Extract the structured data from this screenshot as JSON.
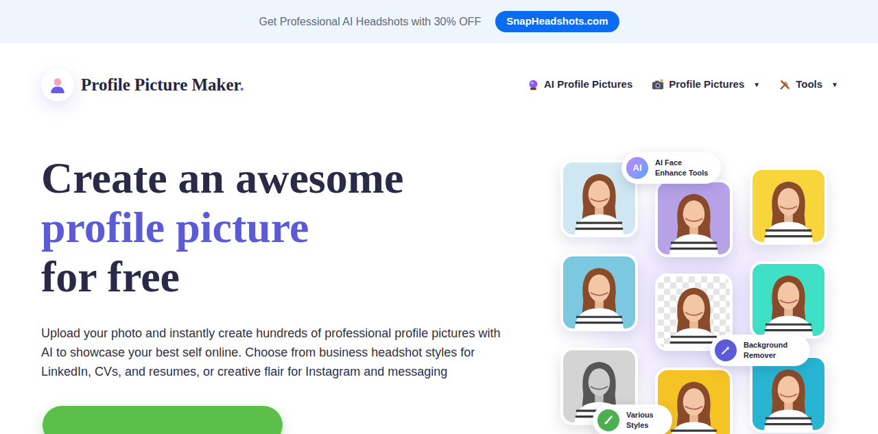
{
  "banner": {
    "text": "Get Professional AI Headshots with 30% OFF",
    "button": "SnapHeadshots.com"
  },
  "logo": {
    "name": "Profile Picture Maker",
    "dot": "."
  },
  "nav": [
    {
      "label": "AI Profile Pictures"
    },
    {
      "label": "Profile Pictures",
      "arrow": "▼"
    },
    {
      "label": "Tools",
      "arrow": "▼"
    }
  ],
  "hero": {
    "lines": [
      {
        "text": "Create an awesome",
        "accent": false
      },
      {
        "text": "profile picture",
        "accent": true
      },
      {
        "text": "for free",
        "accent": false
      }
    ],
    "description": "Upload your photo and instantly create hundreds of professional profile pictures with AI to showcase your best self online. Choose from business headshot styles for LinkedIn, CVs, and resumes, or creative flair for Instagram and messaging"
  },
  "collage": {
    "columns": [
      {
        "tiles": [
          {
            "kind": "photo",
            "color": "#cfe7f2"
          },
          {
            "kind": "photo",
            "color": "#7cc8e0"
          },
          {
            "kind": "grayscale",
            "color": "#d4d4d4"
          }
        ]
      },
      {
        "tiles": [
          {
            "kind": "photo",
            "color": "#b7a2e8"
          },
          {
            "kind": "transparent",
            "color": "#e5e5e5"
          },
          {
            "kind": "photo",
            "color": "#f6c324"
          }
        ]
      },
      {
        "tiles": [
          {
            "kind": "photo",
            "color": "#f8d53c"
          },
          {
            "kind": "photo",
            "color": "#3fe0c5"
          },
          {
            "kind": "photo",
            "color": "#27b5d3"
          }
        ]
      }
    ],
    "badges": [
      {
        "icon_text": "AI",
        "lines": [
          "AI Face",
          "Enhance Tools"
        ]
      },
      {
        "lines": [
          "Background",
          "Remover"
        ]
      },
      {
        "lines": [
          "Various",
          "Styles"
        ]
      }
    ]
  }
}
